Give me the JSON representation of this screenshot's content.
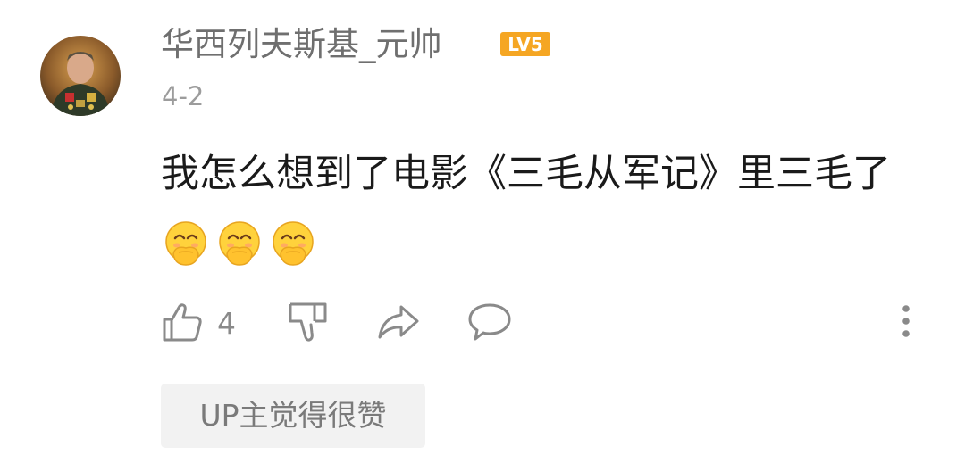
{
  "comment": {
    "username": "华西列夫斯基_元帅",
    "level_badge": "LV5",
    "date": "4-2",
    "content": "我怎么想到了电影《三毛从军记》里三毛了",
    "emojis": [
      "laugh-cover-mouth-emoji",
      "laugh-cover-mouth-emoji",
      "laugh-cover-mouth-emoji"
    ],
    "like_count": "4",
    "up_tag": "UP主觉得很赞"
  },
  "colors": {
    "username": "#6f6f6f",
    "date": "#9c9c9c",
    "content": "#1a1a1a",
    "action_icon": "#8a8a8a",
    "level_badge": "#f5a623",
    "tag_background": "#f2f2f2"
  }
}
